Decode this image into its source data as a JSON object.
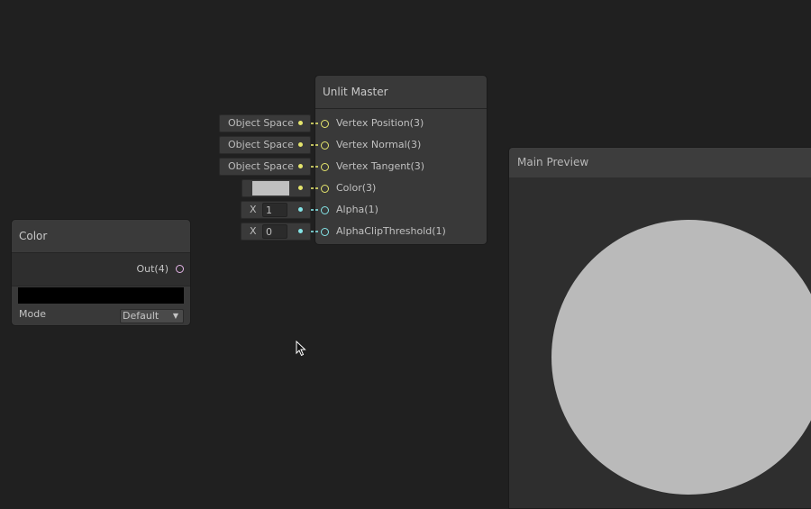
{
  "colors": {
    "vector3": "#e4e46c",
    "vector1": "#84e4e7",
    "vector4": "#e4b4e7",
    "preview_sphere": "#bababa"
  },
  "master": {
    "title": "Unlit Master",
    "ports": [
      {
        "label": "Vertex Position(3)",
        "type": "vector3",
        "input": "Object Space"
      },
      {
        "label": "Vertex Normal(3)",
        "type": "vector3",
        "input": "Object Space"
      },
      {
        "label": "Vertex Tangent(3)",
        "type": "vector3",
        "input": "Object Space"
      },
      {
        "label": "Color(3)",
        "type": "vector3",
        "input_color": "#c0c0c0"
      },
      {
        "label": "Alpha(1)",
        "type": "vector1",
        "axis": "X",
        "value": "1"
      },
      {
        "label": "AlphaClipThreshold(1)",
        "type": "vector1",
        "axis": "X",
        "value": "0"
      }
    ]
  },
  "color_node": {
    "title": "Color",
    "output": "Out(4)",
    "swatch": "#000000",
    "mode_label": "Mode",
    "mode_value": "Default"
  },
  "preview": {
    "title": "Main Preview"
  }
}
